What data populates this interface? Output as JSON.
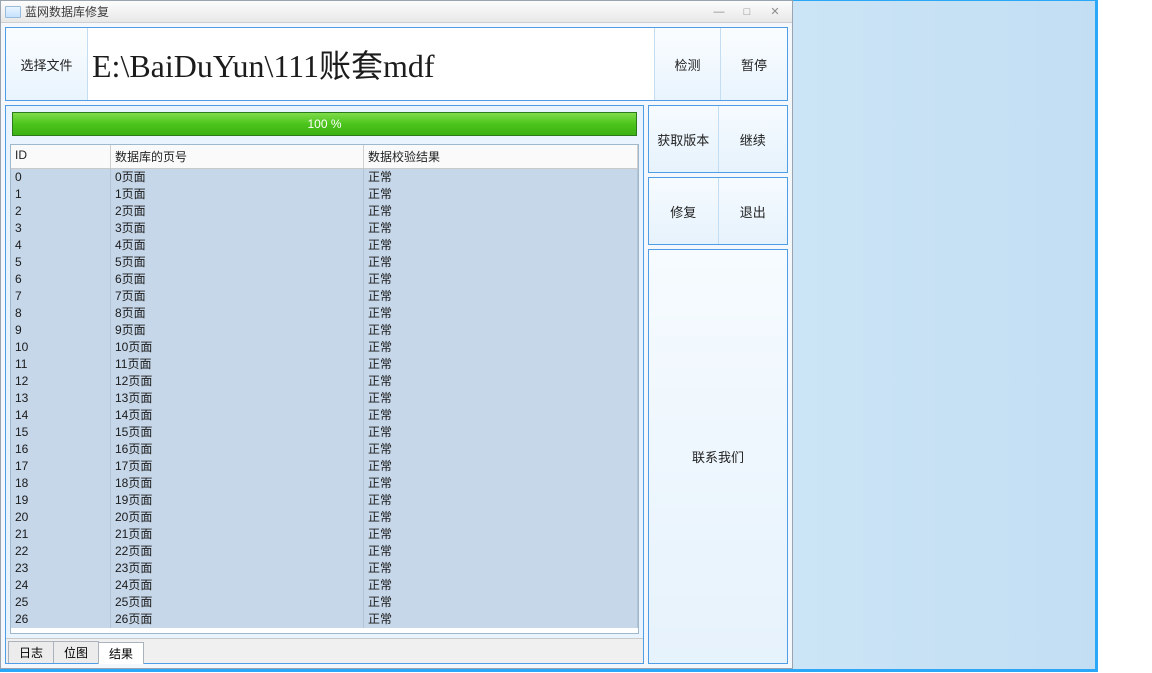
{
  "window": {
    "title": "蓝网数据库修复",
    "min_icon": "—",
    "max_icon": "□",
    "close_icon": "✕"
  },
  "top": {
    "choose_file": "选择文件",
    "path": "E:\\BaiDuYun\\111账套mdf",
    "detect": "检测",
    "pause": "暂停"
  },
  "progress": {
    "label": "100 %"
  },
  "columns": {
    "id": "ID",
    "page": "数据库的页号",
    "result": "数据校验结果"
  },
  "rows": [
    {
      "id": "0",
      "page": "0页面",
      "result": "正常"
    },
    {
      "id": "1",
      "page": "1页面",
      "result": "正常"
    },
    {
      "id": "2",
      "page": "2页面",
      "result": "正常"
    },
    {
      "id": "3",
      "page": "3页面",
      "result": "正常"
    },
    {
      "id": "4",
      "page": "4页面",
      "result": "正常"
    },
    {
      "id": "5",
      "page": "5页面",
      "result": "正常"
    },
    {
      "id": "6",
      "page": "6页面",
      "result": "正常"
    },
    {
      "id": "7",
      "page": "7页面",
      "result": "正常"
    },
    {
      "id": "8",
      "page": "8页面",
      "result": "正常"
    },
    {
      "id": "9",
      "page": "9页面",
      "result": "正常"
    },
    {
      "id": "10",
      "page": "10页面",
      "result": "正常"
    },
    {
      "id": "11",
      "page": "11页面",
      "result": "正常"
    },
    {
      "id": "12",
      "page": "12页面",
      "result": "正常"
    },
    {
      "id": "13",
      "page": "13页面",
      "result": "正常"
    },
    {
      "id": "14",
      "page": "14页面",
      "result": "正常"
    },
    {
      "id": "15",
      "page": "15页面",
      "result": "正常"
    },
    {
      "id": "16",
      "page": "16页面",
      "result": "正常"
    },
    {
      "id": "17",
      "page": "17页面",
      "result": "正常"
    },
    {
      "id": "18",
      "page": "18页面",
      "result": "正常"
    },
    {
      "id": "19",
      "page": "19页面",
      "result": "正常"
    },
    {
      "id": "20",
      "page": "20页面",
      "result": "正常"
    },
    {
      "id": "21",
      "page": "21页面",
      "result": "正常"
    },
    {
      "id": "22",
      "page": "22页面",
      "result": "正常"
    },
    {
      "id": "23",
      "page": "23页面",
      "result": "正常"
    },
    {
      "id": "24",
      "page": "24页面",
      "result": "正常"
    },
    {
      "id": "25",
      "page": "25页面",
      "result": "正常"
    },
    {
      "id": "26",
      "page": "26页面",
      "result": "正常"
    }
  ],
  "tabs": {
    "log": "日志",
    "bitmap": "位图",
    "result": "结果",
    "active": "result"
  },
  "right": {
    "get_version": "获取版本",
    "continue": "继续",
    "repair": "修复",
    "exit": "退出",
    "contact": "联系我们"
  }
}
